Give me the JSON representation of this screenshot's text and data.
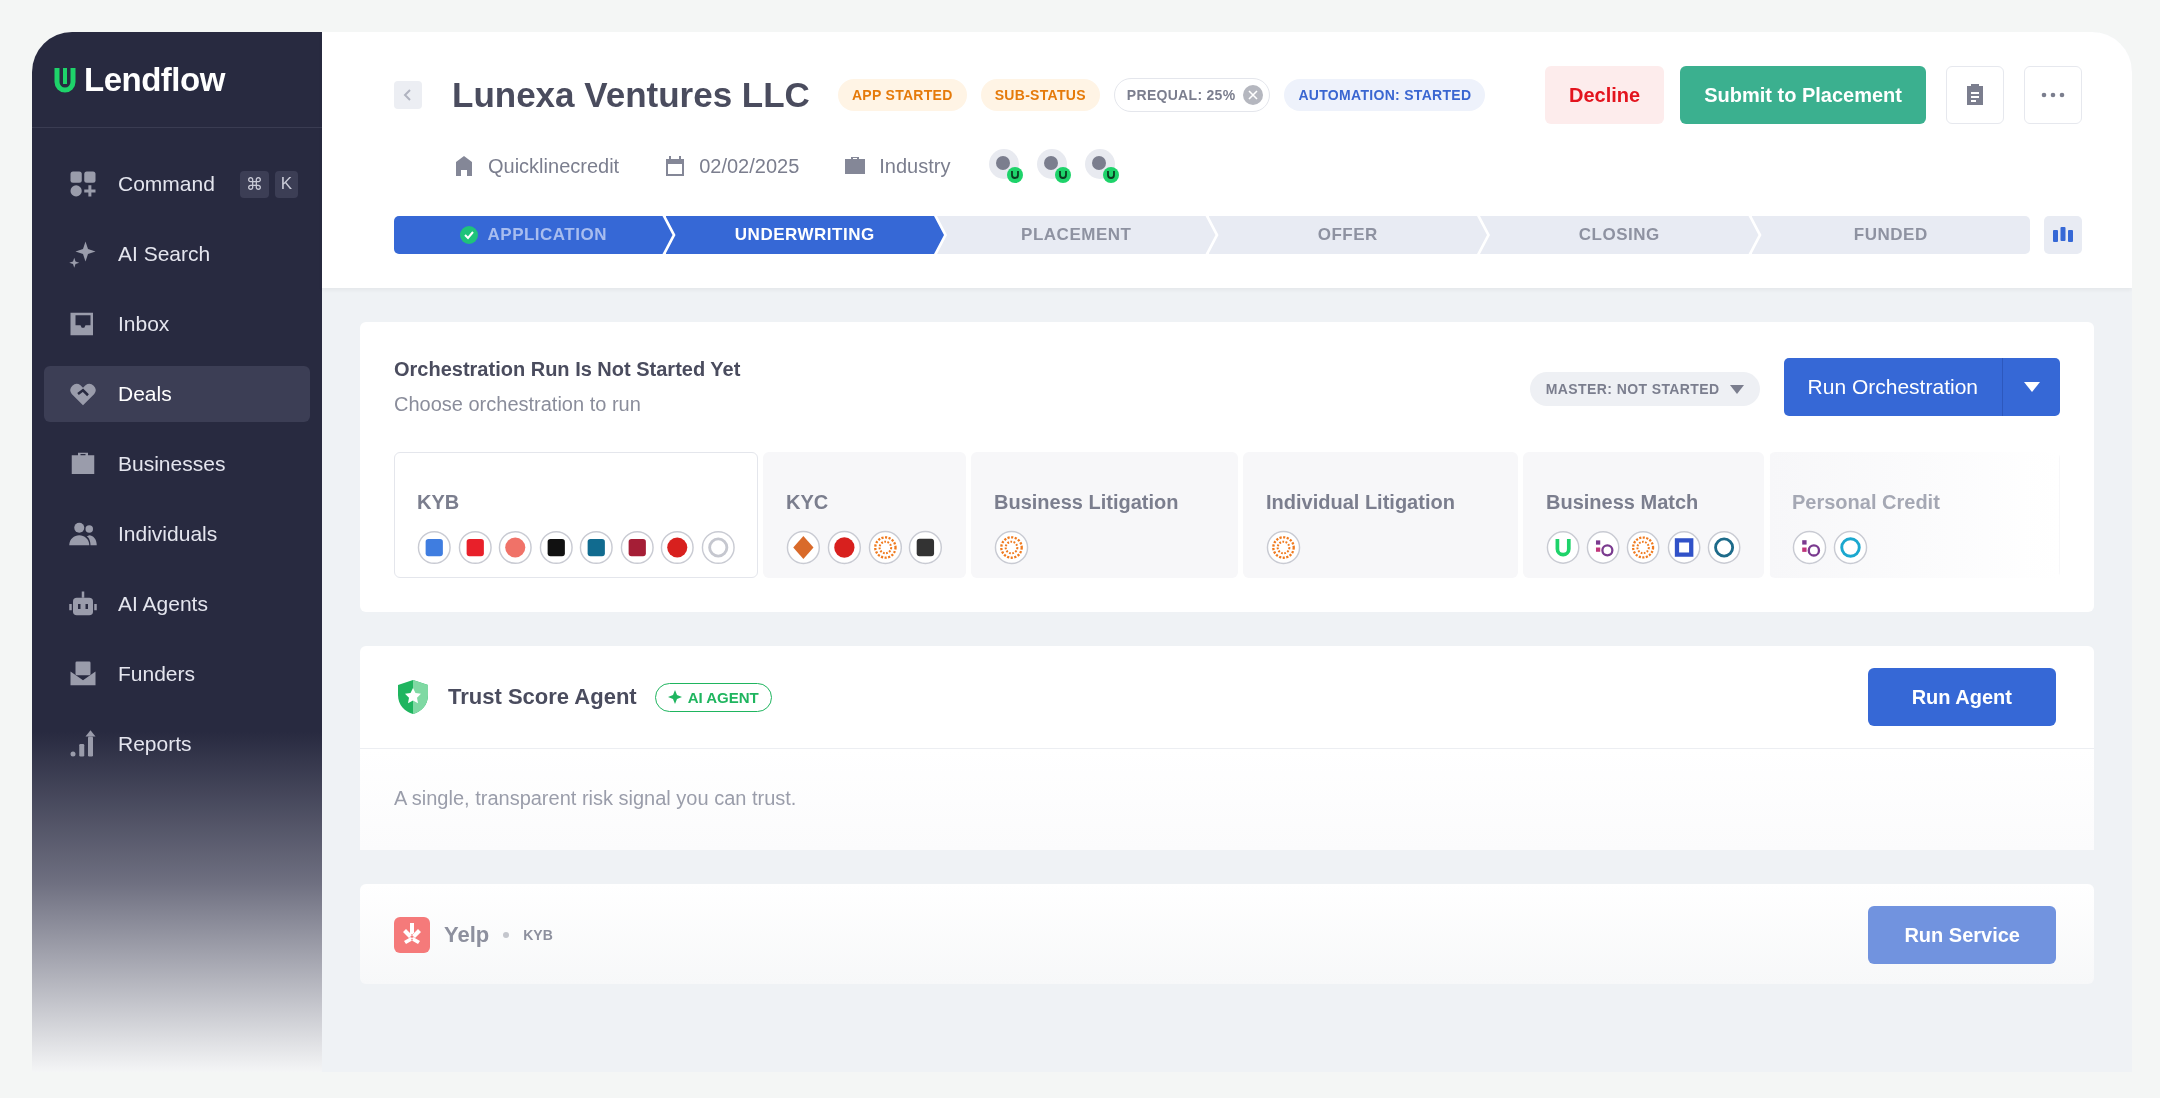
{
  "sidebar": {
    "logo": "Lendflow",
    "items": [
      {
        "label": "Command",
        "selected": false,
        "shortcut": [
          "⌘",
          "K"
        ]
      },
      {
        "label": "AI Search",
        "selected": false
      },
      {
        "label": "Inbox",
        "selected": false
      },
      {
        "label": "Deals",
        "selected": true
      },
      {
        "label": "Businesses",
        "selected": false
      },
      {
        "label": "Individuals",
        "selected": false
      },
      {
        "label": "AI Agents",
        "selected": false
      },
      {
        "label": "Funders",
        "selected": false
      },
      {
        "label": "Reports",
        "selected": false
      }
    ]
  },
  "header": {
    "title": "Lunexa Ventures LLC",
    "badges": [
      {
        "kind": "warning",
        "text": "APP STARTED"
      },
      {
        "kind": "warning",
        "text": "SUB-STATUS"
      },
      {
        "kind": "removable",
        "text": "PREQUAL: 25%"
      },
      {
        "kind": "info",
        "text": "AUTOMATION: STARTED"
      }
    ],
    "actions": [
      {
        "kind": "danger",
        "label": "Decline"
      },
      {
        "kind": "primary",
        "label": "Submit to Placement"
      }
    ],
    "meta": [
      {
        "kind": "lender",
        "text": "Quicklinecredit"
      },
      {
        "kind": "date",
        "text": "02/02/2025"
      },
      {
        "kind": "industry",
        "text": "Industry"
      }
    ],
    "stages": [
      {
        "label": "APPLICATION",
        "completed": true,
        "selected": false
      },
      {
        "label": "UNDERWRITING",
        "completed": false,
        "selected": true
      },
      {
        "label": "PLACEMENT",
        "completed": false,
        "selected": false
      },
      {
        "label": "OFFER",
        "completed": false,
        "selected": false
      },
      {
        "label": "CLOSING",
        "completed": false,
        "selected": false
      },
      {
        "label": "FUNDED",
        "completed": false,
        "selected": false
      }
    ]
  },
  "orchestration": {
    "title": "Orchestration Run Is Not Started Yet",
    "subtitle": "Choose orchestration to run",
    "status_filter": "MASTER: NOT STARTED",
    "run_button": "Run Orchestration",
    "categories": [
      {
        "name": "KYB",
        "selected": true
      },
      {
        "name": "KYC",
        "selected": false
      },
      {
        "name": "Business Litigation",
        "selected": false
      },
      {
        "name": "Individual Litigation",
        "selected": false
      },
      {
        "name": "Business Match",
        "selected": false
      },
      {
        "name": "Personal Credit",
        "selected": false
      }
    ]
  },
  "agent_card": {
    "title": "Trust Score Agent",
    "badge": "AI AGENT",
    "button": "Run Agent",
    "description": "A single, transparent risk signal you can trust."
  },
  "service_card": {
    "title": "Yelp",
    "category": "KYB",
    "button": "Run Service",
    "disabled": true
  }
}
